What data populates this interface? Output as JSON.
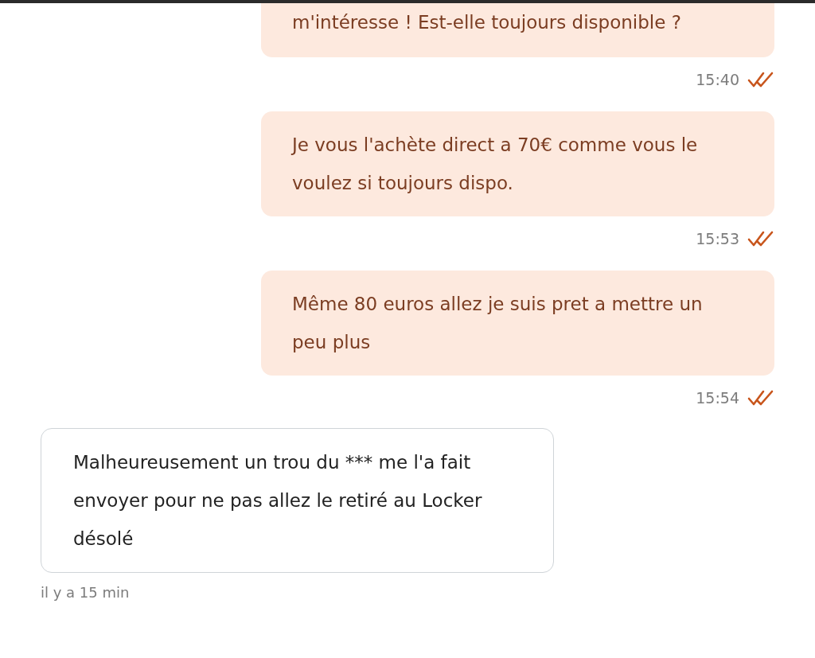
{
  "messages": [
    {
      "kind": "outgoing",
      "text": "m'intéresse ! Est-elle toujours disponible ?",
      "time": "15:40",
      "read": true
    },
    {
      "kind": "outgoing",
      "text": "Je vous l'achète direct a 70€ comme vous le voulez si toujours dispo.",
      "time": "15:53",
      "read": true
    },
    {
      "kind": "outgoing",
      "text": "Même 80 euros allez je suis pret a mettre un peu plus",
      "time": "15:54",
      "read": true
    },
    {
      "kind": "incoming",
      "text": "Malheureusement un trou du *** me l'a fait envoyer pour ne pas allez le retiré au Locker désolé",
      "time": "il y a 15 min"
    }
  ]
}
